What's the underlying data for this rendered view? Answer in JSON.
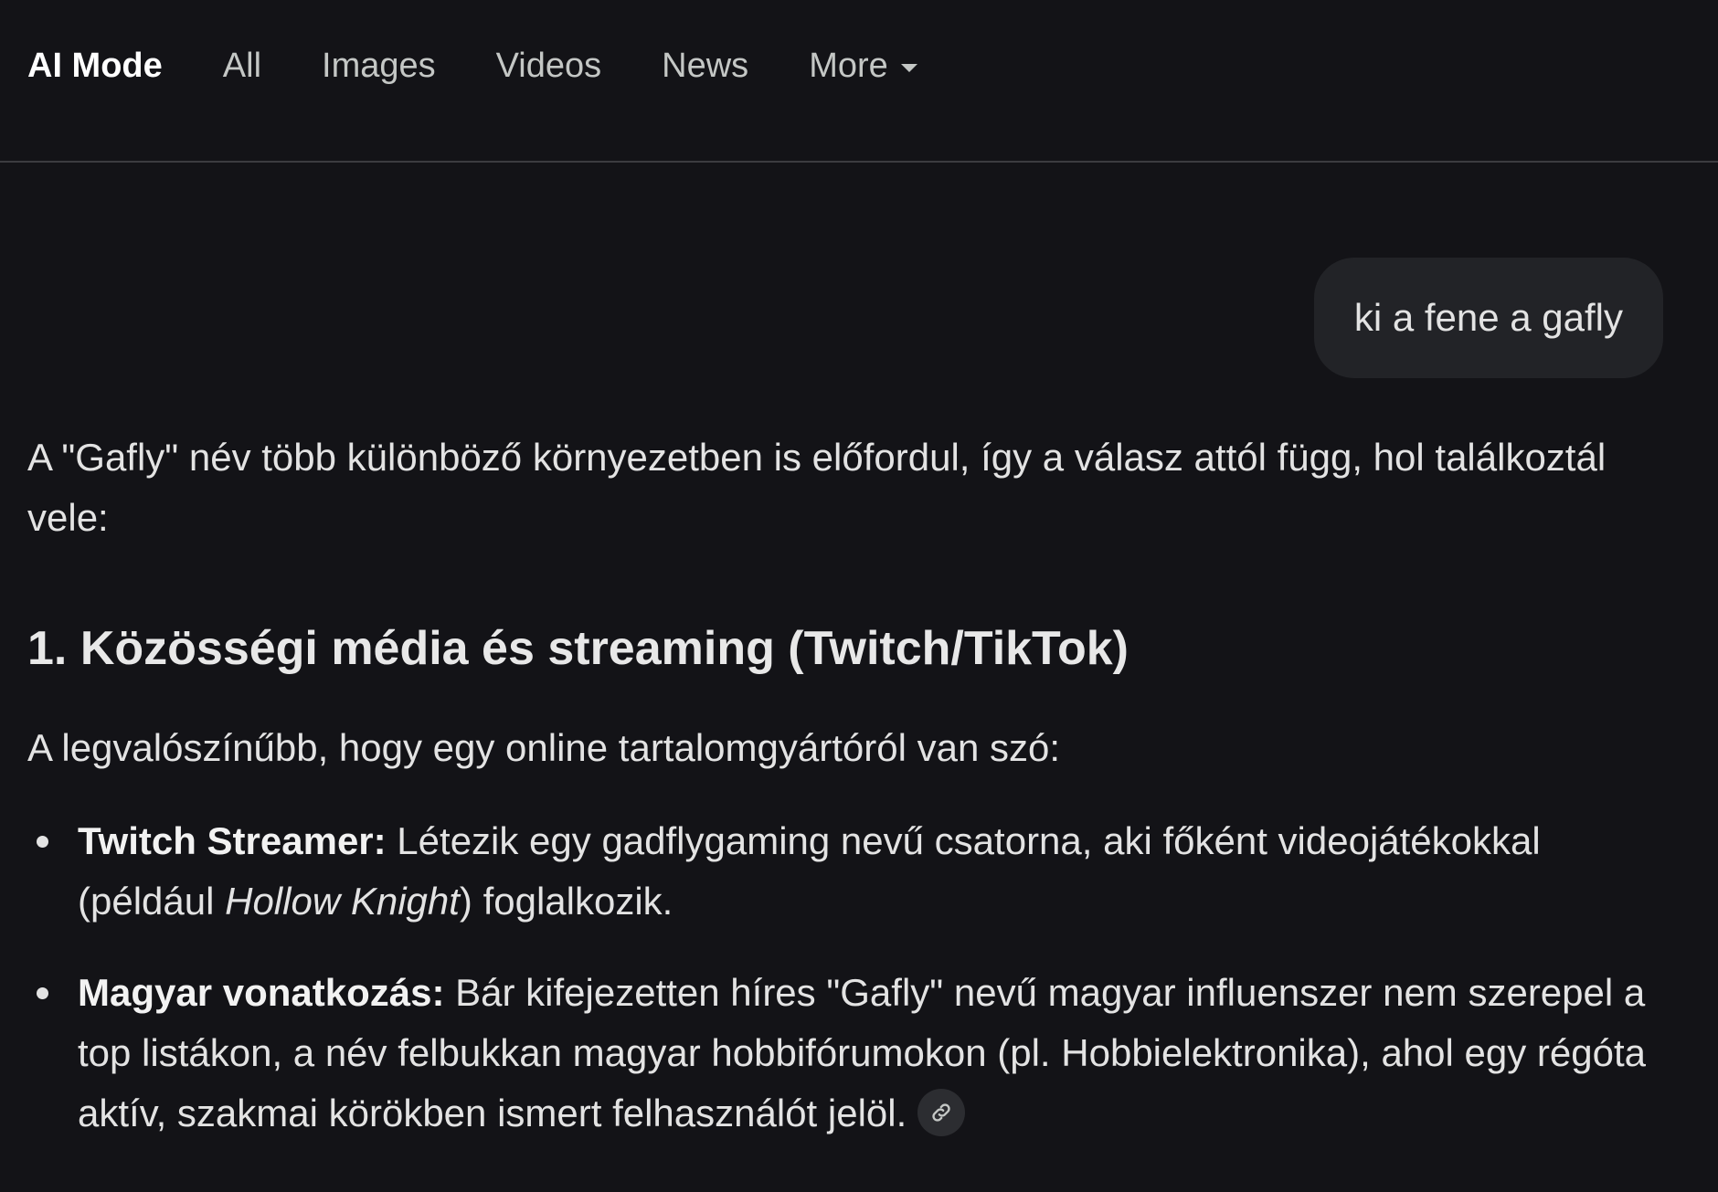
{
  "nav": {
    "tabs": [
      {
        "label": "AI Mode",
        "active": true
      },
      {
        "label": "All"
      },
      {
        "label": "Images"
      },
      {
        "label": "Videos"
      },
      {
        "label": "News"
      },
      {
        "label": "More"
      }
    ]
  },
  "query": "ki a fene a gafly",
  "answer": {
    "intro_paragraph": "A \"Gafly\" név több különböző környezetben is előfordul, így a válasz attól függ, hol találkoztál vele:",
    "section_heading": "1. Közösségi média és streaming (Twitch/TikTok)",
    "section_intro": "A legvalószínűbb, hogy egy online tartalomgyártóról van szó:",
    "bullets": [
      {
        "bold": "Twitch Streamer:",
        "text_1": " Létezik egy gadflygaming nevű csatorna, aki főként videojátékokkal (például ",
        "italic": "Hollow Knight",
        "text_2": ") foglalkozik."
      },
      {
        "bold": "Magyar vonatkozás:",
        "text_1": " Bár kifejezetten híres \"Gafly\" nevű magyar influenszer nem szerepel a top listákon, a név felbukkan magyar hobbifórumokon (pl. Hobbielektronika), ahol egy régóta aktív, szakmai körökben ismert felhasználót jelöl."
      }
    ]
  },
  "icons": {
    "more_caret": "chevron-down-icon",
    "source_link": "link-icon"
  }
}
